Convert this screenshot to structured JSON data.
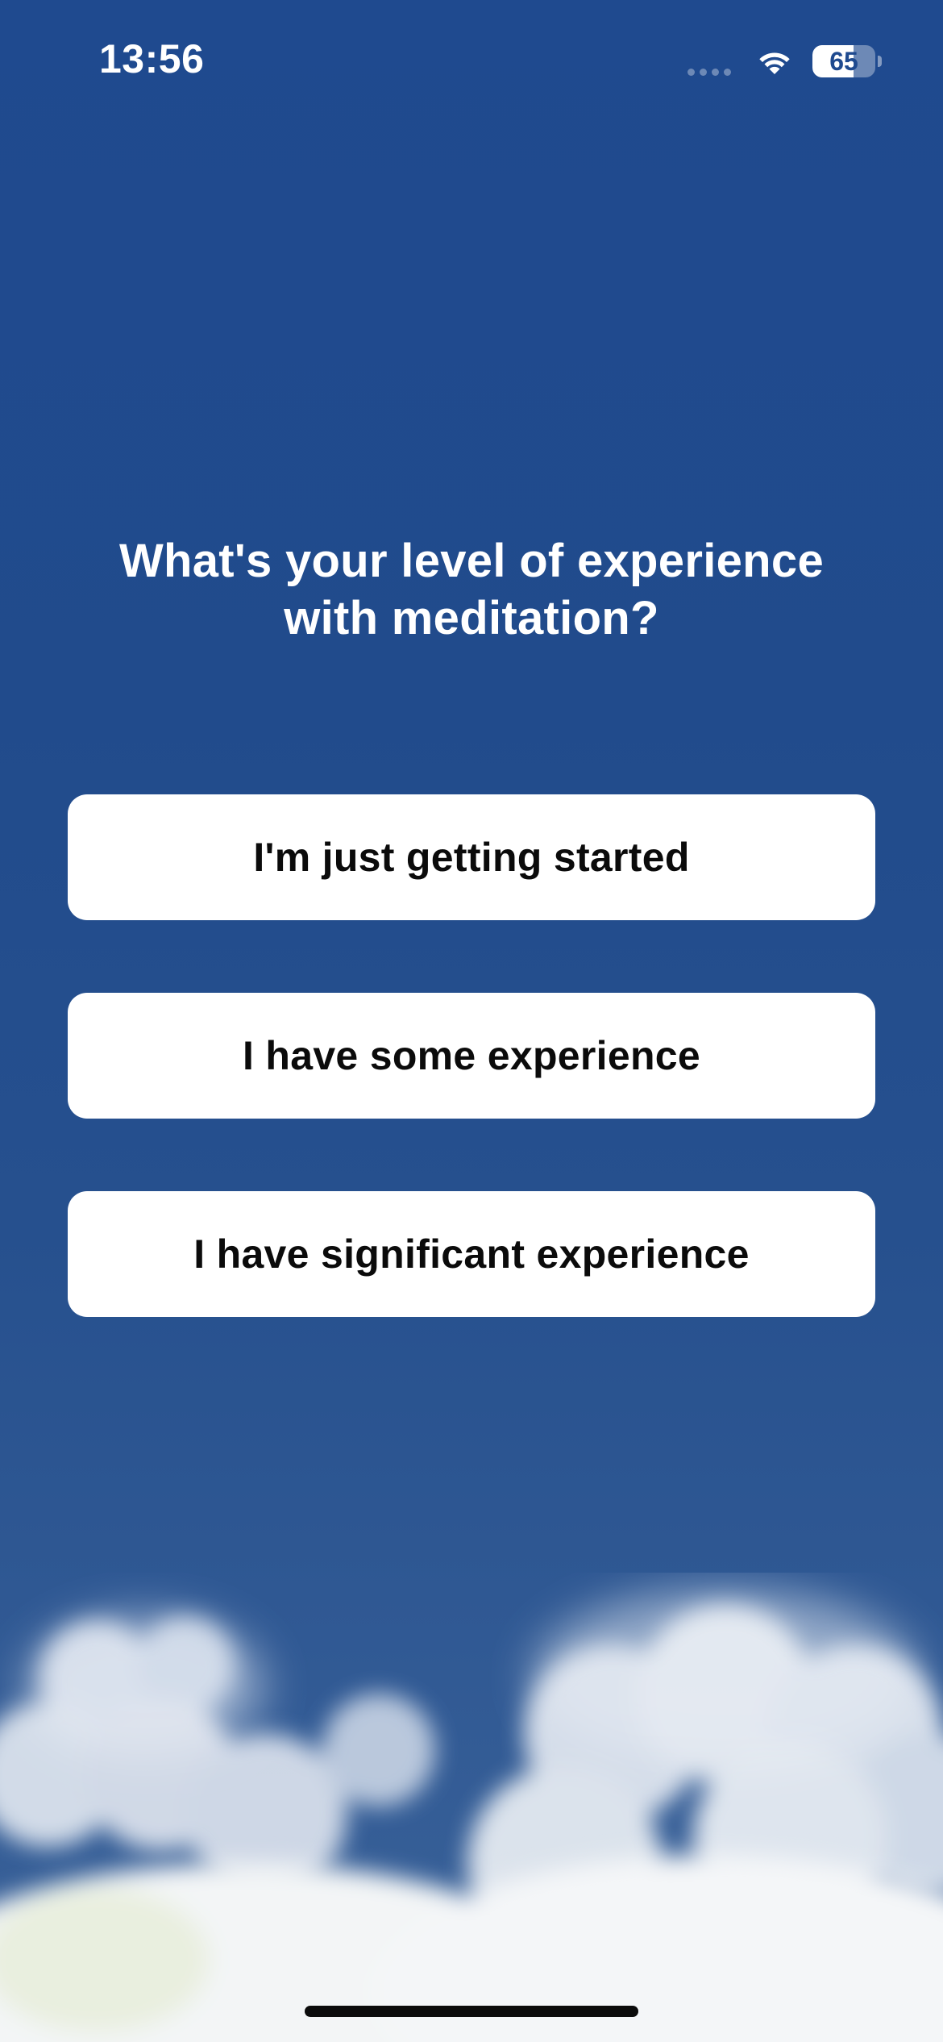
{
  "status_bar": {
    "time": "13:56",
    "battery_level": "65",
    "battery_fraction": 0.65,
    "icons": [
      "cellular-signal-icon",
      "wifi-icon",
      "battery-icon"
    ]
  },
  "question": {
    "title": "What's your level of experience with meditation?"
  },
  "options": [
    {
      "label": "I'm just getting started"
    },
    {
      "label": "I have some experience"
    },
    {
      "label": "I have significant experience"
    }
  ],
  "colors": {
    "background_top": "#1f4a8f",
    "background_bottom": "#3a6299",
    "button_background": "#ffffff",
    "button_text": "#0b0b0b",
    "title_text": "#ffffff"
  }
}
